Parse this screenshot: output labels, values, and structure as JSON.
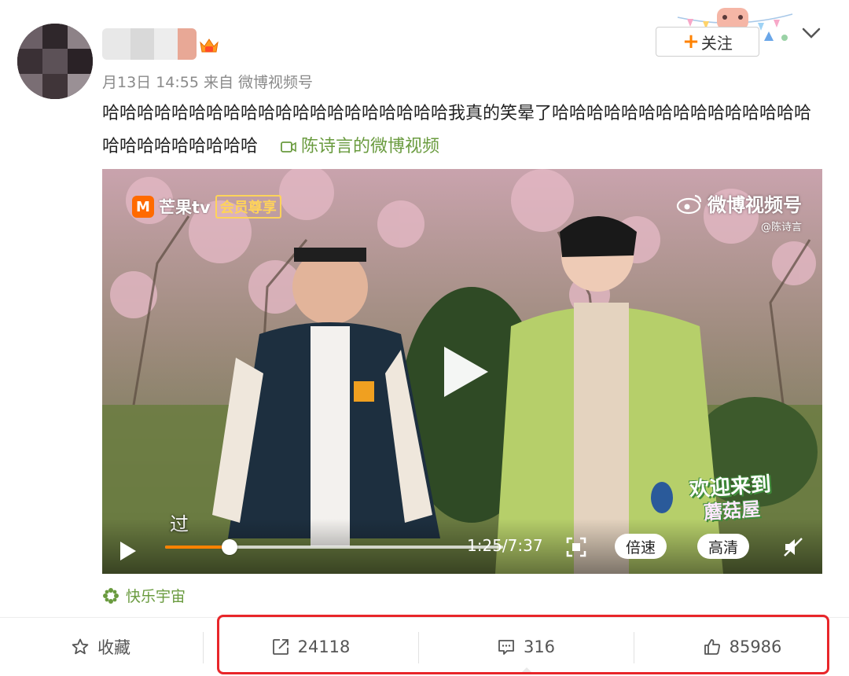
{
  "post": {
    "meta": "月13日 14:55 来自 微博视频号",
    "text": "哈哈哈哈哈哈哈哈哈哈哈哈哈哈哈哈哈哈哈哈我真的笑晕了哈哈哈哈哈哈哈哈哈哈哈哈哈哈哈哈哈哈哈哈哈哈哈哈",
    "video_link": "陈诗言的微博视频",
    "follow_label": "关注",
    "follow_plus": "+"
  },
  "video": {
    "brand_left": "芒果tv",
    "brand_left_vip": "会员尊享",
    "brand_right": "微博视频号",
    "brand_right_sub": "@陈诗言",
    "subtitle": "过",
    "welcome_line1": "欢迎来到",
    "welcome_line2": "蘑菇屋",
    "time": "1:25/7:37",
    "progress": 0.19,
    "speed_label": "倍速",
    "quality_label": "高清"
  },
  "source": {
    "label": "快乐宇宙"
  },
  "actions": {
    "favorite": "收藏",
    "repost": "24118",
    "comment": "316",
    "like": "85986"
  },
  "colors": {
    "accent": "#ff8200",
    "link": "#6a9b3f",
    "highlight": "#e8262a"
  },
  "icons": [
    "star-icon",
    "repost-icon",
    "comment-icon",
    "like-icon",
    "play-icon",
    "fullscreen-icon",
    "mute-icon",
    "chevron-down-icon",
    "video-link-icon",
    "flower-icon"
  ]
}
